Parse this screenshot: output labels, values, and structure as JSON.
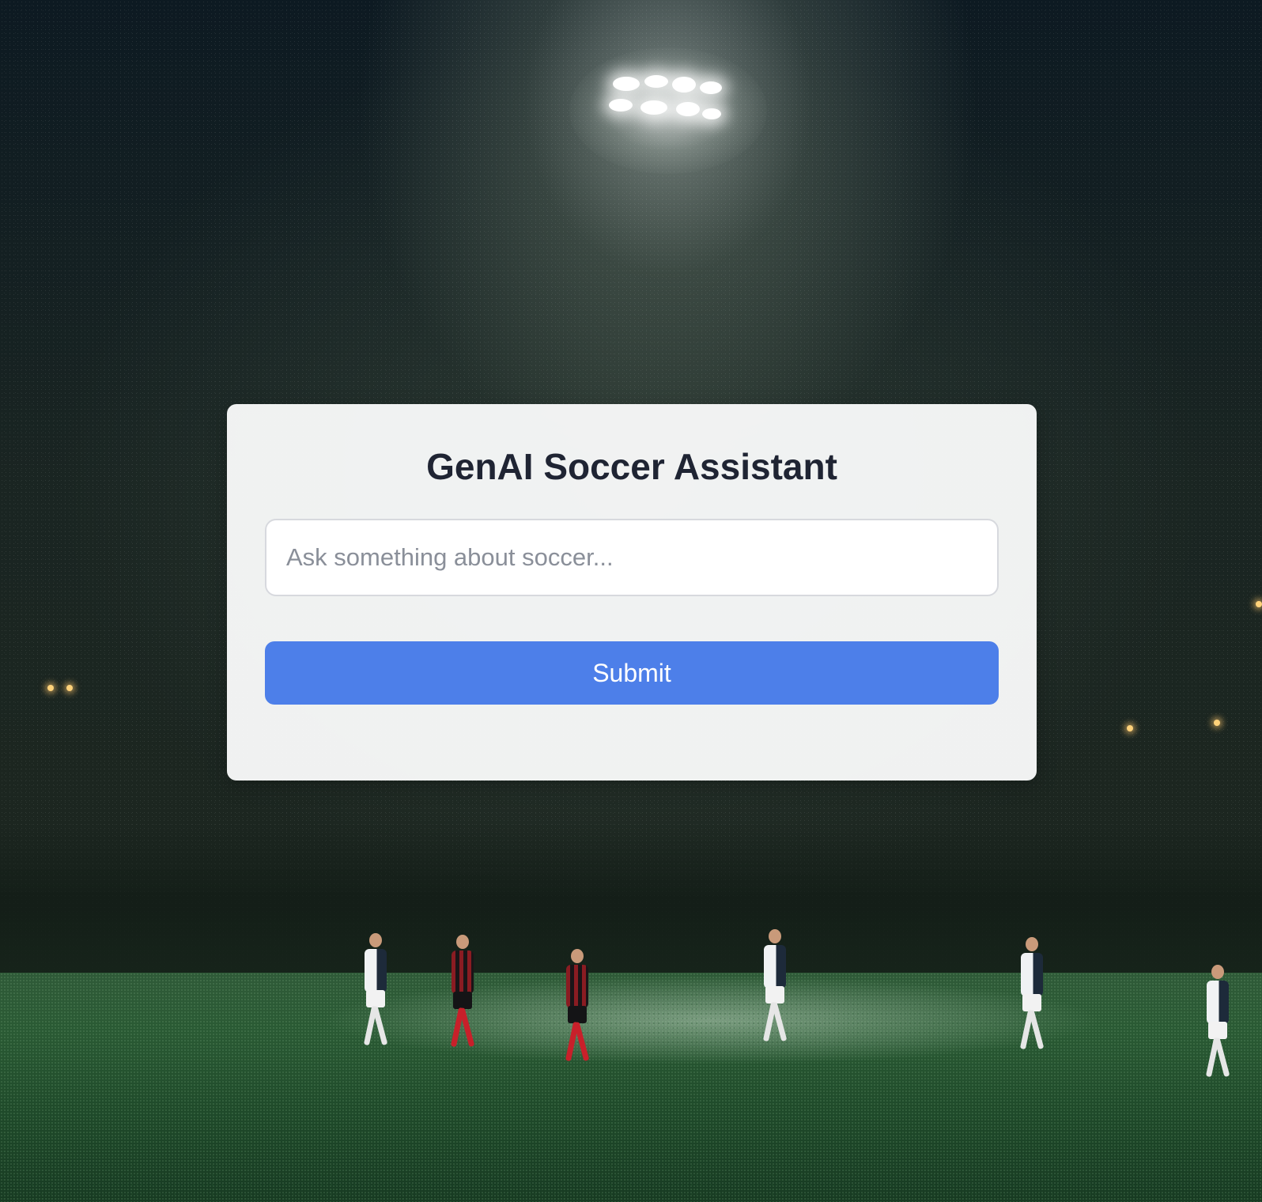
{
  "app": {
    "title": "GenAI Soccer Assistant"
  },
  "form": {
    "question_placeholder": "Ask something about soccer...",
    "question_value": "",
    "submit_label": "Submit"
  },
  "theme": {
    "accent": "#4d7fe9",
    "card_background": "#f5f6f6",
    "title_color": "#1f2433"
  },
  "background": {
    "scene": "night soccer match under floodlight"
  }
}
